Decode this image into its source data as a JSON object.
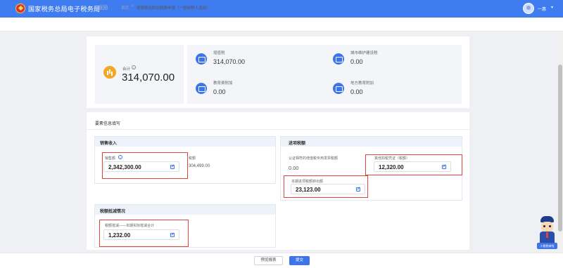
{
  "header": {
    "site_title": "国家税务总局电子税务局",
    "user_name": "一惠",
    "user_caret": "▾"
  },
  "breadcrumb": {
    "back": "← 返回",
    "home": "首页",
    "separator": ">",
    "current": "增值税及附加税费申报（一般纳税人适用）"
  },
  "summary": {
    "total_label": "合计",
    "total_value": "314,070.00",
    "taxes": [
      {
        "label": "增值税",
        "value": "314,070.00",
        "icon": "vat-invoice-icon"
      },
      {
        "label": "城市维护建设税",
        "value": "0.00",
        "icon": "urban-construction-tax-icon"
      },
      {
        "label": "教育费附加",
        "value": "0.00",
        "icon": "education-surcharge-icon"
      },
      {
        "label": "地方教育附加",
        "value": "0.00",
        "icon": "local-education-surcharge-icon"
      }
    ]
  },
  "form": {
    "title": "要素信息填写",
    "sales": {
      "title": "销售收入",
      "sales_amount_label": "销售额",
      "sales_amount_value": "2,342,300.00",
      "tax_label": "税额",
      "tax_value": "304,499.00"
    },
    "input_tax": {
      "title": "进项税额",
      "certified_label": "认证相符的增值税专用发票税额",
      "certified_value": "0.00",
      "other_label": "其他扣税凭证（税额）",
      "other_value": "12,320.00",
      "transfer_label": "本期进项税额转出额",
      "transfer_value": "23,123.00"
    },
    "reduction": {
      "title": "税额抵减情况",
      "label": "税额抵减——本期实际抵减合计",
      "value": "1,232.00"
    }
  },
  "footer": {
    "preview_label": "预览报表",
    "submit_label": "提交"
  },
  "mascot": {
    "badge": "小税税来啦"
  },
  "colors": {
    "brand_blue": "#3f7cf0",
    "highlight_red": "#e0453a",
    "accent_orange": "#f5a623"
  }
}
